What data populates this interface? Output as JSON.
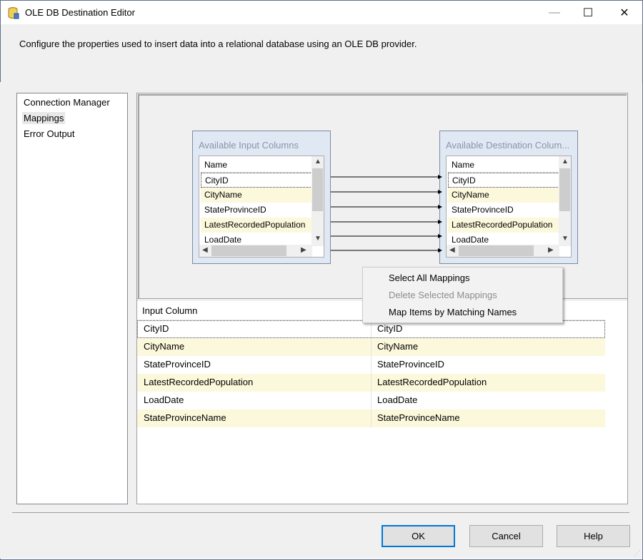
{
  "window": {
    "title": "OLE DB Destination Editor"
  },
  "description": "Configure the properties used to insert data into a relational database using an OLE DB provider.",
  "nav": {
    "items": [
      {
        "label": "Connection Manager",
        "selected": false
      },
      {
        "label": "Mappings",
        "selected": true
      },
      {
        "label": "Error Output",
        "selected": false
      }
    ]
  },
  "input_box": {
    "title": "Available Input Columns",
    "header": "Name",
    "rows": [
      "CityID",
      "CityName",
      "StateProvinceID",
      "LatestRecordedPopulation",
      "LoadDate"
    ]
  },
  "dest_box": {
    "title": "Available Destination Colum...",
    "header": "Name",
    "rows": [
      "CityID",
      "CityName",
      "StateProvinceID",
      "LatestRecordedPopulation",
      "LoadDate"
    ]
  },
  "context_menu": {
    "items": [
      {
        "label": "Select All Mappings",
        "enabled": true
      },
      {
        "label": "Delete Selected Mappings",
        "enabled": false
      },
      {
        "label": "Map Items by Matching Names",
        "enabled": true
      }
    ]
  },
  "grid": {
    "header_input": "Input Column",
    "rows": [
      {
        "input": "CityID",
        "dest": "CityID"
      },
      {
        "input": "CityName",
        "dest": "CityName"
      },
      {
        "input": "StateProvinceID",
        "dest": "StateProvinceID"
      },
      {
        "input": "LatestRecordedPopulation",
        "dest": "LatestRecordedPopulation"
      },
      {
        "input": "LoadDate",
        "dest": "LoadDate"
      },
      {
        "input": "StateProvinceName",
        "dest": "StateProvinceName"
      }
    ]
  },
  "buttons": {
    "ok": "OK",
    "cancel": "Cancel",
    "help": "Help"
  },
  "colors": {
    "row_highlight": "#fcf8dc",
    "primary_border": "#0078d7",
    "box_bg": "#dfe8f3"
  }
}
